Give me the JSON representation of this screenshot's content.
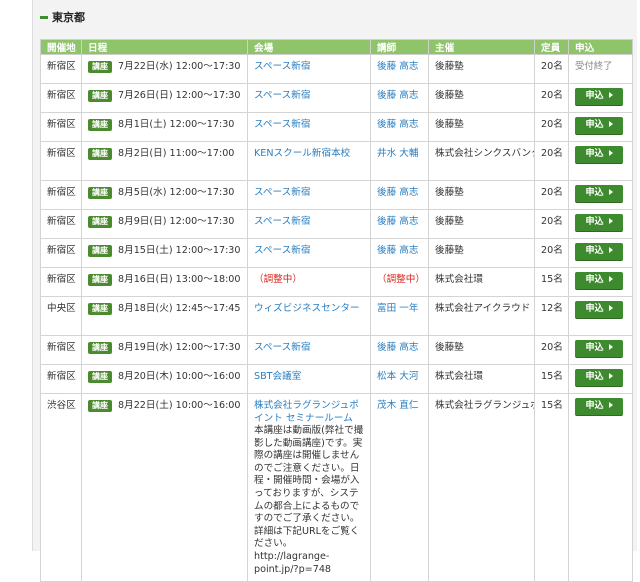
{
  "section": {
    "title": "東京都"
  },
  "headers": [
    "開催地",
    "日程",
    "会場",
    "講師",
    "主催",
    "定員",
    "申込"
  ],
  "badge_label": "講座",
  "apply_label": "申込",
  "rows": [
    {
      "area": "新宿区",
      "date": "7月22日(水) 12:00〜17:30",
      "venue": "スペース新宿",
      "lecturer": "後藤 高志",
      "host": "後藤塾",
      "capacity": "20名",
      "status": "受付終了"
    },
    {
      "area": "新宿区",
      "date": "7月26日(日) 12:00〜17:30",
      "venue": "スペース新宿",
      "lecturer": "後藤 高志",
      "host": "後藤塾",
      "capacity": "20名",
      "status": "apply"
    },
    {
      "area": "新宿区",
      "date": "8月1日(土) 12:00〜17:30",
      "venue": "スペース新宿",
      "lecturer": "後藤 高志",
      "host": "後藤塾",
      "capacity": "20名",
      "status": "apply"
    },
    {
      "area": "新宿区",
      "date": "8月2日(日) 11:00〜17:00",
      "venue": "KENスクール新宿本校",
      "lecturer": "井水 大輔",
      "host": "株式会社シンクスバンク",
      "capacity": "20名",
      "status": "apply"
    },
    {
      "area": "新宿区",
      "date": "8月5日(水) 12:00〜17:30",
      "venue": "スペース新宿",
      "lecturer": "後藤 高志",
      "host": "後藤塾",
      "capacity": "20名",
      "status": "apply"
    },
    {
      "area": "新宿区",
      "date": "8月9日(日) 12:00〜17:30",
      "venue": "スペース新宿",
      "lecturer": "後藤 高志",
      "host": "後藤塾",
      "capacity": "20名",
      "status": "apply"
    },
    {
      "area": "新宿区",
      "date": "8月15日(土) 12:00〜17:30",
      "venue": "スペース新宿",
      "lecturer": "後藤 高志",
      "host": "後藤塾",
      "capacity": "20名",
      "status": "apply"
    },
    {
      "area": "新宿区",
      "date": "8月16日(日) 13:00〜18:00",
      "venue": "（調整中）",
      "lecturer": "（調整中）",
      "host": "株式会社環",
      "capacity": "15名",
      "status": "apply",
      "adjusting": true
    },
    {
      "area": "中央区",
      "date": "8月18日(火) 12:45〜17:45",
      "venue": "ウィズビジネスセンター",
      "lecturer": "富田 一年",
      "host": "株式会社アイクラウド",
      "capacity": "12名",
      "status": "apply"
    },
    {
      "area": "新宿区",
      "date": "8月19日(水) 12:00〜17:30",
      "venue": "スペース新宿",
      "lecturer": "後藤 高志",
      "host": "後藤塾",
      "capacity": "20名",
      "status": "apply"
    },
    {
      "area": "新宿区",
      "date": "8月20日(木) 10:00〜16:00",
      "venue": "SBT会議室",
      "lecturer": "松本 大河",
      "host": "株式会社環",
      "capacity": "15名",
      "status": "apply"
    },
    {
      "area": "渋谷区",
      "date": "8月22日(土) 10:00〜16:00",
      "venue": "株式会社ラグランジュポイント セミナールーム",
      "venue_note": "本講座は動画版(弊社で撮影した動画講座)です。実際の講座は開催しませんのでご注意ください。日程・開催時間・会場が入っておりますが、システムの都合上によるものですのでご了承ください。詳細は下記URLをご覧ください。 http://lagrange-point.jp/?p=748",
      "lecturer": "茂木 直仁",
      "host": "株式会社ラグランジュポイント",
      "capacity": "15名",
      "status": "apply"
    }
  ]
}
